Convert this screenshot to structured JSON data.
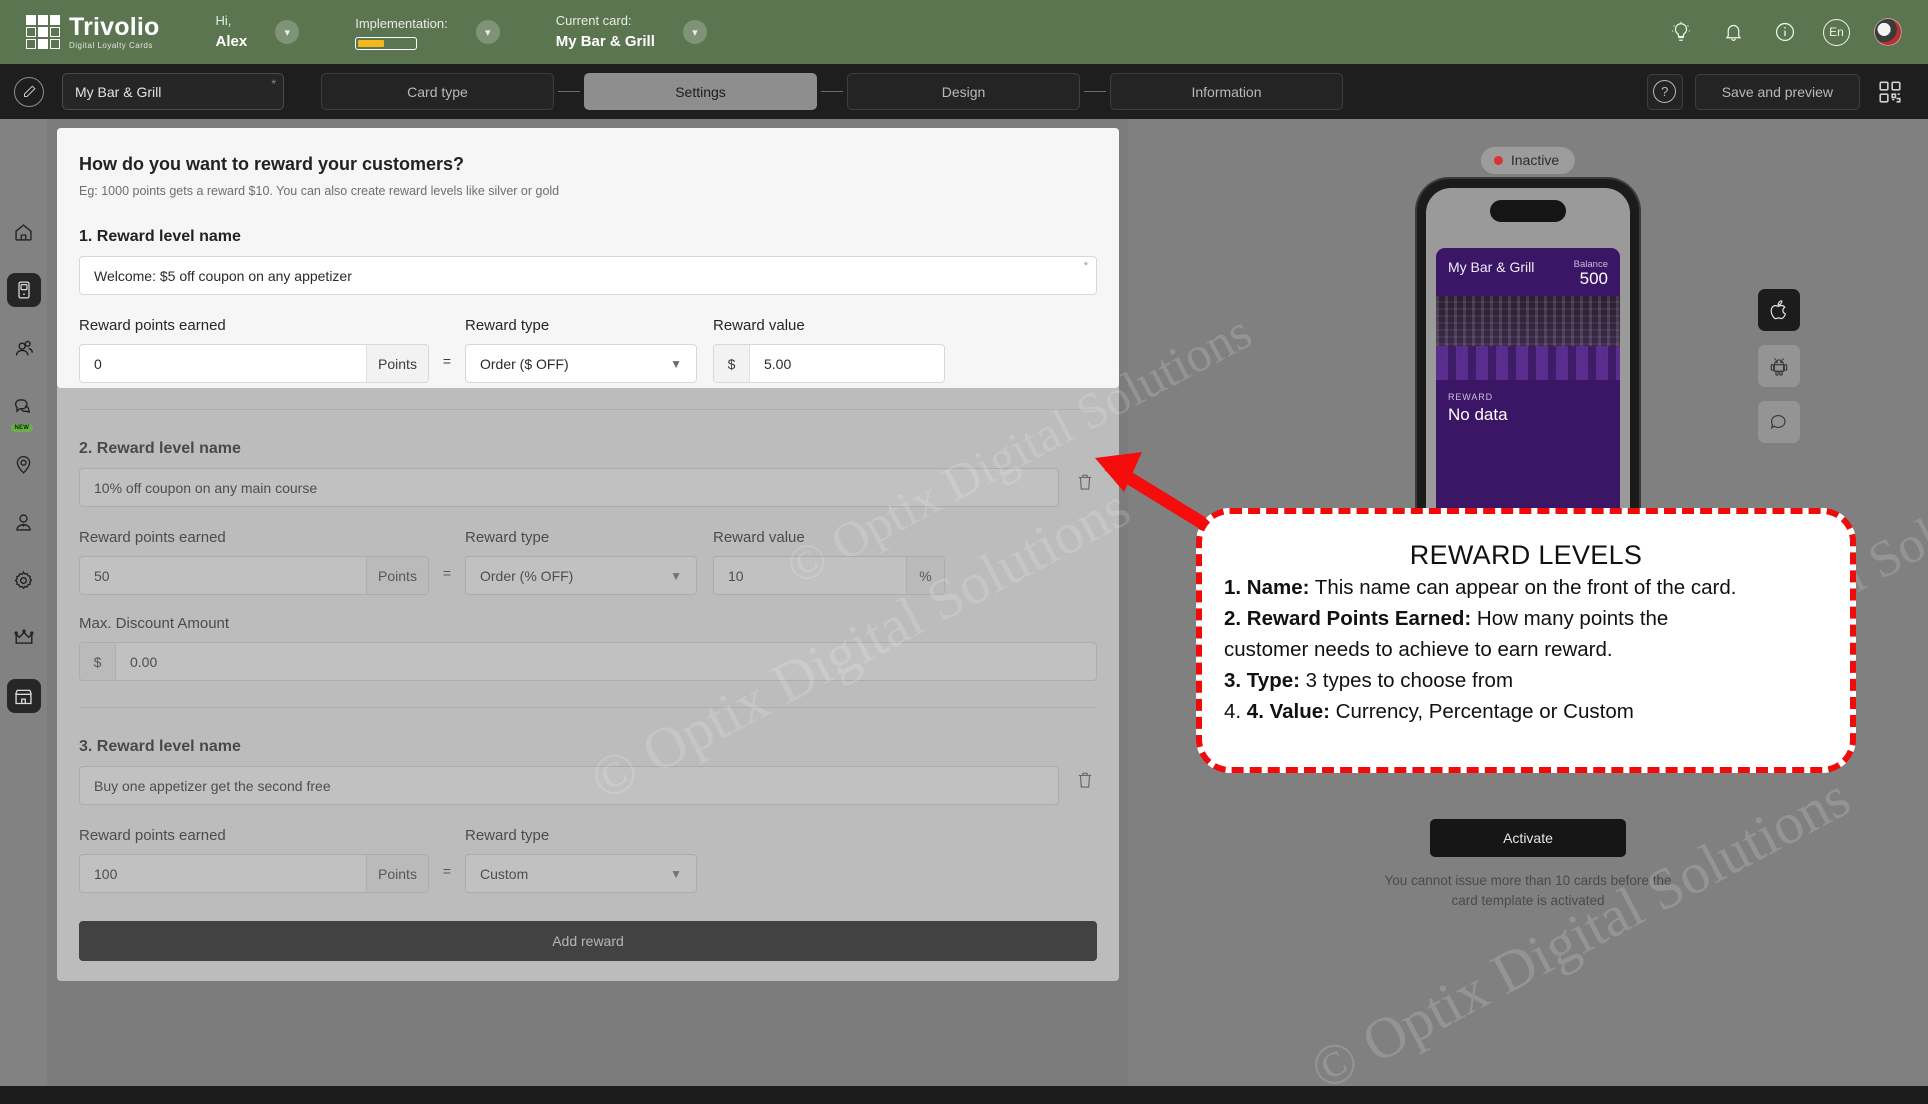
{
  "header": {
    "logo_name": "Trivolio",
    "logo_tagline": "Digital Loyalty Cards",
    "greeting_label": "Hi,",
    "greeting_value": "Alex",
    "implementation_label": "Implementation:",
    "current_card_label": "Current card:",
    "current_card_value": "My Bar & Grill",
    "language": "En",
    "icons": [
      "lightbulb-icon",
      "bell-icon",
      "info-icon",
      "language-icon",
      "avatar"
    ]
  },
  "subbar": {
    "card_name": "My Bar & Grill",
    "required_marker": "*",
    "steps": [
      {
        "label": "Card type",
        "active": false
      },
      {
        "label": "Settings",
        "active": true
      },
      {
        "label": "Design",
        "active": false
      },
      {
        "label": "Information",
        "active": false
      }
    ],
    "help_label": "?",
    "save_label": "Save and preview"
  },
  "sidebar": {
    "items": [
      {
        "name": "home",
        "selected": false,
        "badge": ""
      },
      {
        "name": "cards",
        "selected": true,
        "badge": ""
      },
      {
        "name": "customers",
        "selected": false,
        "badge": ""
      },
      {
        "name": "messages",
        "selected": false,
        "badge": "NEW"
      },
      {
        "name": "locations",
        "selected": false,
        "badge": ""
      },
      {
        "name": "staff",
        "selected": false,
        "badge": ""
      },
      {
        "name": "settings",
        "selected": false,
        "badge": ""
      },
      {
        "name": "subscription",
        "selected": false,
        "badge": ""
      },
      {
        "name": "store",
        "selected": true,
        "badge": ""
      }
    ]
  },
  "form": {
    "title": "How do you want to reward your customers?",
    "subtitle": "Eg: 1000 points gets a reward $10. You can also create reward levels like silver or gold",
    "labels": {
      "points_earned": "Reward points earned",
      "reward_type": "Reward type",
      "reward_value": "Reward value",
      "max_discount": "Max. Discount Amount",
      "points_suffix": "Points",
      "equals": "=",
      "currency_prefix": "$",
      "percent_suffix": "%"
    },
    "levels": [
      {
        "heading": "1. Reward level name",
        "name": "Welcome: $5 off coupon on any appetizer",
        "points": "0",
        "type": "Order ($ OFF)",
        "value": "5.00",
        "value_kind": "currency",
        "deletable": false
      },
      {
        "heading": "2. Reward level name",
        "name": "10% off coupon on any main course",
        "points": "50",
        "type": "Order (% OFF)",
        "value": "10",
        "value_kind": "percent",
        "max_discount": "0.00",
        "deletable": true
      },
      {
        "heading": "3. Reward level name",
        "name": "Buy one appetizer get the second free",
        "points": "100",
        "type": "Custom",
        "value": "",
        "value_kind": "none",
        "deletable": true
      }
    ],
    "add_reward_label": "Add reward"
  },
  "preview": {
    "status": "Inactive",
    "card": {
      "brand": "My Bar & Grill",
      "balance_label": "Balance",
      "balance_value": "500",
      "reward_label": "REWARD",
      "reward_value": "No data"
    },
    "platforms": [
      {
        "name": "apple-icon",
        "active": true
      },
      {
        "name": "android-icon",
        "active": false
      },
      {
        "name": "chat-icon",
        "active": false
      }
    ],
    "activate_label": "Activate",
    "activate_note": "You cannot issue more than 10 cards before the card template is activated"
  },
  "callout": {
    "title": "REWARD LEVELS",
    "lines": [
      {
        "bold": "1. Name:",
        "rest": " This name can appear on the front of the card."
      },
      {
        "bold": "2. Reward Points Earned:",
        "rest": " How many points the"
      },
      {
        "bold": "",
        "rest": "customer needs to achieve to earn reward."
      },
      {
        "bold": "3. Type:",
        "rest": " 3 types to choose from"
      },
      {
        "bold": "4. Value:",
        "rest": " Currency, Percentage or Custom",
        "lead": "4. "
      }
    ]
  },
  "watermarks": [
    "© Optix Digital Solutions",
    "© Optix Digital Solutions"
  ],
  "colors": {
    "header_green": "#5b7550",
    "accent_yellow": "#f5b81a",
    "callout_red": "#f00a0a",
    "card_purple": "#3b1566",
    "status_red": "#e03131"
  }
}
